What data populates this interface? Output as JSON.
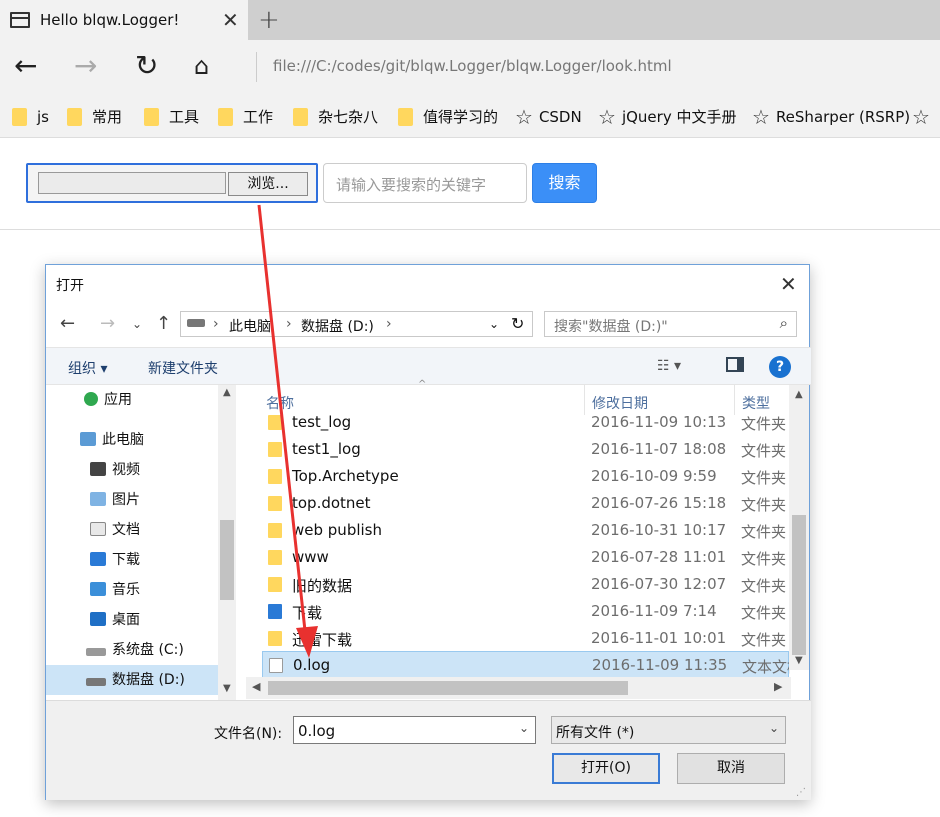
{
  "browser": {
    "tab_title": "Hello blqw.Logger!",
    "address": "file:///C:/codes/git/blqw.Logger/blqw.Logger/look.html",
    "bookmarks": [
      {
        "label": "js",
        "icon": "folder-icon"
      },
      {
        "label": "常用",
        "icon": "folder-icon"
      },
      {
        "label": "工具",
        "icon": "folder-icon"
      },
      {
        "label": "工作",
        "icon": "folder-icon"
      },
      {
        "label": "杂七杂八",
        "icon": "folder-icon"
      },
      {
        "label": "值得学习的",
        "icon": "folder-icon"
      },
      {
        "label": "CSDN",
        "icon": "star-icon"
      },
      {
        "label": "jQuery 中文手册",
        "icon": "star-icon"
      },
      {
        "label": "ReSharper (RSRP)",
        "icon": "star-icon"
      }
    ]
  },
  "page": {
    "browse_label": "浏览...",
    "search_placeholder": "请输入要搜索的关键字",
    "search_button": "搜索",
    "search_button_color": "#3b8ff7"
  },
  "dialog": {
    "title": "打开",
    "path": [
      "此电脑",
      "数据盘 (D:)"
    ],
    "search_placeholder": "搜索\"数据盘 (D:)\"",
    "toolbar": {
      "organize": "组织 ▾",
      "new_folder": "新建文件夹"
    },
    "nav_tree": [
      {
        "label": "应用",
        "icon": "app-icon"
      },
      {
        "label": "此电脑",
        "icon": "computer-icon"
      },
      {
        "label": "视频",
        "icon": "video-icon"
      },
      {
        "label": "图片",
        "icon": "picture-icon"
      },
      {
        "label": "文档",
        "icon": "document-icon"
      },
      {
        "label": "下载",
        "icon": "download-icon"
      },
      {
        "label": "音乐",
        "icon": "music-icon"
      },
      {
        "label": "桌面",
        "icon": "desktop-icon"
      },
      {
        "label": "系统盘 (C:)",
        "icon": "drive-icon"
      },
      {
        "label": "数据盘 (D:)",
        "icon": "drive-icon",
        "selected": true
      }
    ],
    "columns": {
      "name": "名称",
      "date": "修改日期",
      "type": "类型"
    },
    "files": [
      {
        "name": "test_log",
        "date": "2016-11-09 10:13",
        "type": "文件夹"
      },
      {
        "name": "test1_log",
        "date": "2016-11-07 18:08",
        "type": "文件夹"
      },
      {
        "name": "Top.Archetype",
        "date": "2016-10-09 9:59",
        "type": "文件夹"
      },
      {
        "name": "top.dotnet",
        "date": "2016-07-26 15:18",
        "type": "文件夹"
      },
      {
        "name": "web publish",
        "date": "2016-10-31 10:17",
        "type": "文件夹"
      },
      {
        "name": "www",
        "date": "2016-07-28 11:01",
        "type": "文件夹"
      },
      {
        "name": "旧的数据",
        "date": "2016-07-30 12:07",
        "type": "文件夹"
      },
      {
        "name": "下载",
        "date": "2016-11-09 7:14",
        "type": "文件夹"
      },
      {
        "name": "迅雷下载",
        "date": "2016-11-01 10:01",
        "type": "文件夹"
      },
      {
        "name": "0.log",
        "date": "2016-11-09 11:35",
        "type": "文本文档",
        "selected": true
      }
    ],
    "filename_label": "文件名(N):",
    "filename_value": "0.log",
    "filetype_value": "所有文件 (*)",
    "open_button": "打开(O)",
    "cancel_button": "取消"
  },
  "annotation": {
    "color": "#e8312f"
  }
}
